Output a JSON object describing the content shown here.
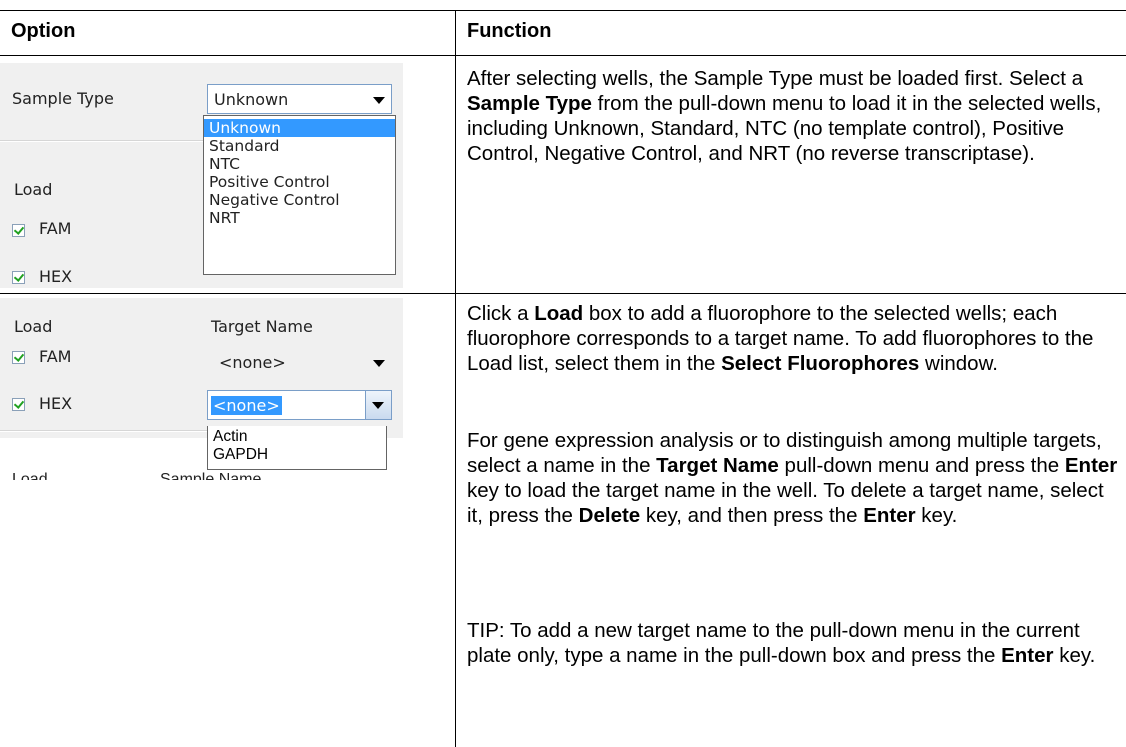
{
  "header": {
    "option": "Option",
    "function": "Function"
  },
  "row1": {
    "panel": {
      "sample_type_label": "Sample Type",
      "sample_type_value": "Unknown",
      "load_label": "Load",
      "fam": "FAM",
      "hex": "HEX",
      "options": [
        "Unknown",
        "Standard",
        "NTC",
        "Positive Control",
        "Negative Control",
        "NRT"
      ],
      "selected_option": "Unknown"
    },
    "text": {
      "p1": "After selecting wells, the Sample Type must be loaded first. Select a ",
      "b1": "Sample Type",
      "p2": " from the pull-down menu to load it in the selected wells, including Unknown, Standard, NTC (no template control), Positive Control, Negative Control, and NRT (no reverse transcriptase)."
    }
  },
  "row2": {
    "panel": {
      "load_label": "Load",
      "target_name_label": "Target Name",
      "fam": "FAM",
      "hex": "HEX",
      "fam_value": "<none>",
      "hex_value": "<none>",
      "options": [
        "Actin",
        "GAPDH"
      ],
      "cut_load": "Load",
      "cut_sample": "Sample Name"
    },
    "para1": {
      "a": "Click a ",
      "b": "Load",
      "c": " box to add a fluorophore to the selected wells; each fluorophore corresponds to a target name. To add fluorophores to the Load list, select them in the ",
      "d": "Select Fluorophores",
      "e": " window."
    },
    "para2": {
      "a": "For gene expression analysis or to distinguish among multiple targets, select a name in the ",
      "b": "Target Name",
      "c": " pull-down menu and press the ",
      "d": "Enter",
      "e": " key to load the target name in the well. To delete a target name, select it, press the ",
      "f": "Delete",
      "g": " key, and then press the ",
      "h": "Enter",
      "i": " key."
    },
    "para3": {
      "a": "TIP: To add a new target name to the pull-down menu in the current plate only, type a name in the pull-down box and press the ",
      "b": "Enter",
      "c": " key."
    }
  }
}
